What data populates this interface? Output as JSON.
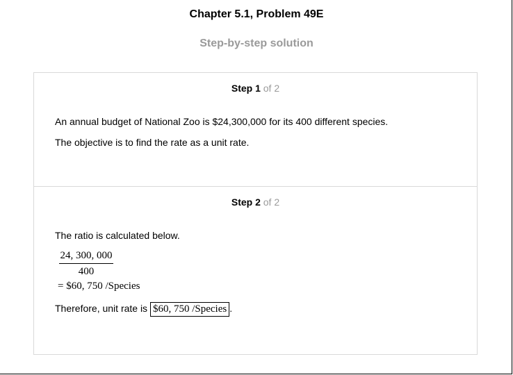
{
  "header": {
    "chapter_title": "Chapter 5.1, Problem 49E",
    "subtitle": "Step-by-step solution"
  },
  "steps": [
    {
      "label": "Step 1",
      "of": "of 2",
      "paragraphs": [
        "An annual budget of National Zoo is $24,300,000 for its 400 different species.",
        "The objective is to find the rate as a unit rate."
      ]
    },
    {
      "label": "Step 2",
      "of": "of 2",
      "intro": "The ratio is calculated below.",
      "fraction_numerator": "24, 300, 000",
      "fraction_denominator": "400",
      "equation": "= $60, 750 /Species",
      "conclusion_prefix": "Therefore, unit rate is",
      "answer": "$60, 750 /Species",
      "conclusion_suffix": "."
    }
  ]
}
